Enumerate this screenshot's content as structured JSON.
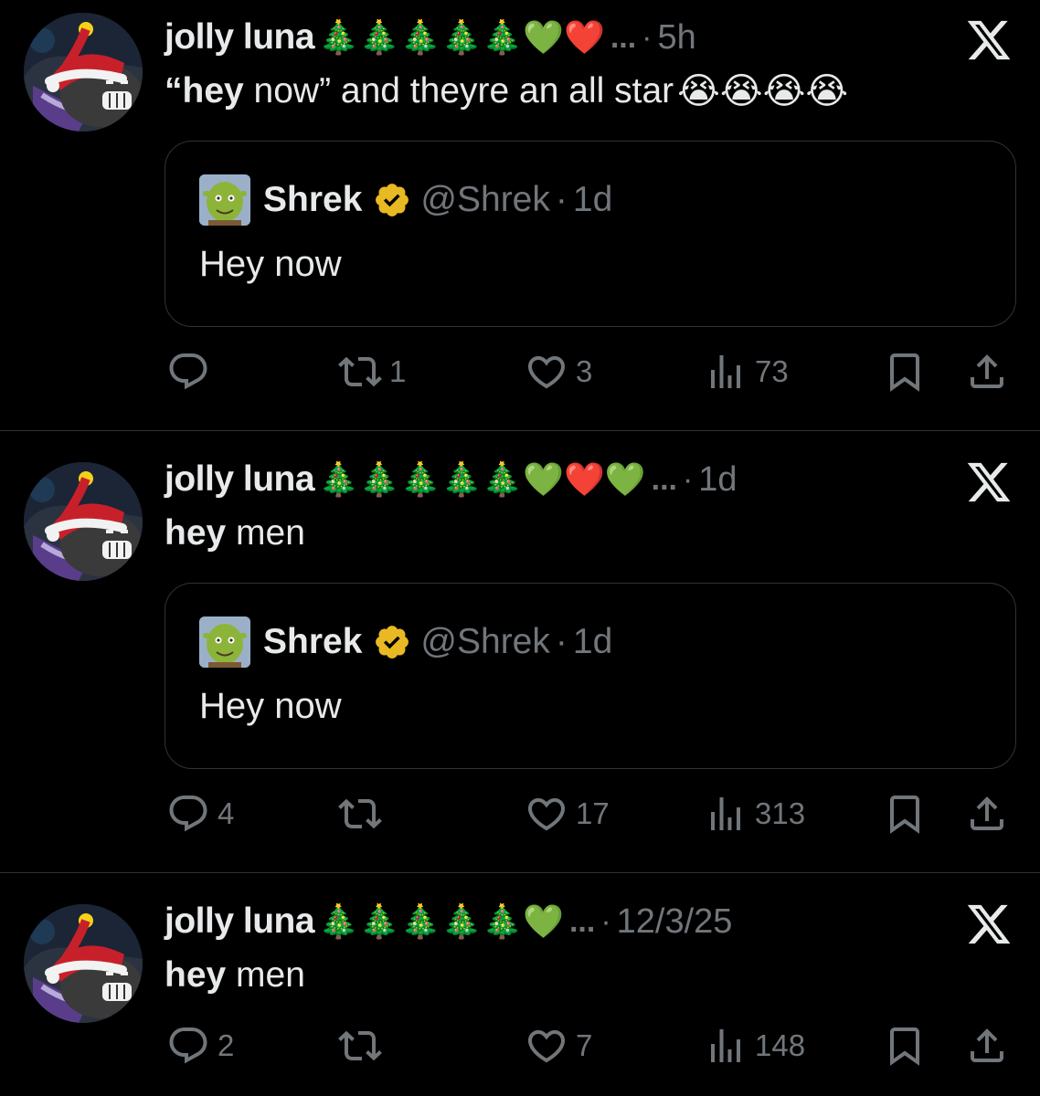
{
  "posts": [
    {
      "author": "jolly luna",
      "name_emojis": "🎄🎄🎄🎄🎄💚❤️",
      "ellipsis": "...",
      "time": "5h",
      "text_bold": "“hey",
      "text_rest": " now” and theyre an all star",
      "sob_emoji": "😭😭😭😭",
      "quote": {
        "name": "Shrek",
        "handle": "@Shrek",
        "time": "1d",
        "text": "Hey now"
      },
      "replies": "",
      "reposts": "1",
      "likes": "3",
      "views": "73"
    },
    {
      "author": "jolly luna",
      "name_emojis": "🎄🎄🎄🎄🎄💚❤️💚",
      "ellipsis": "...",
      "time": "1d",
      "text_bold": "hey",
      "text_rest": " men",
      "quote": {
        "name": "Shrek",
        "handle": "@Shrek",
        "time": "1d",
        "text": "Hey now"
      },
      "replies": "4",
      "reposts": "",
      "likes": "17",
      "views": "313"
    },
    {
      "author": "jolly luna",
      "name_emojis": "🎄🎄🎄🎄🎄💚",
      "ellipsis": "...",
      "time": "12/3/25",
      "text_bold": "hey",
      "text_rest": " men",
      "replies": "2",
      "reposts": "",
      "likes": "7",
      "views": "148"
    }
  ],
  "colors": {
    "background": "#000000",
    "text": "#e7e9ea",
    "muted": "#71767b",
    "border": "#2f3336",
    "verified": "#e8b923"
  },
  "icons": [
    "x-logo-icon",
    "reply-icon",
    "repost-icon",
    "like-icon",
    "views-icon",
    "bookmark-icon",
    "share-icon",
    "verified-badge-icon"
  ]
}
